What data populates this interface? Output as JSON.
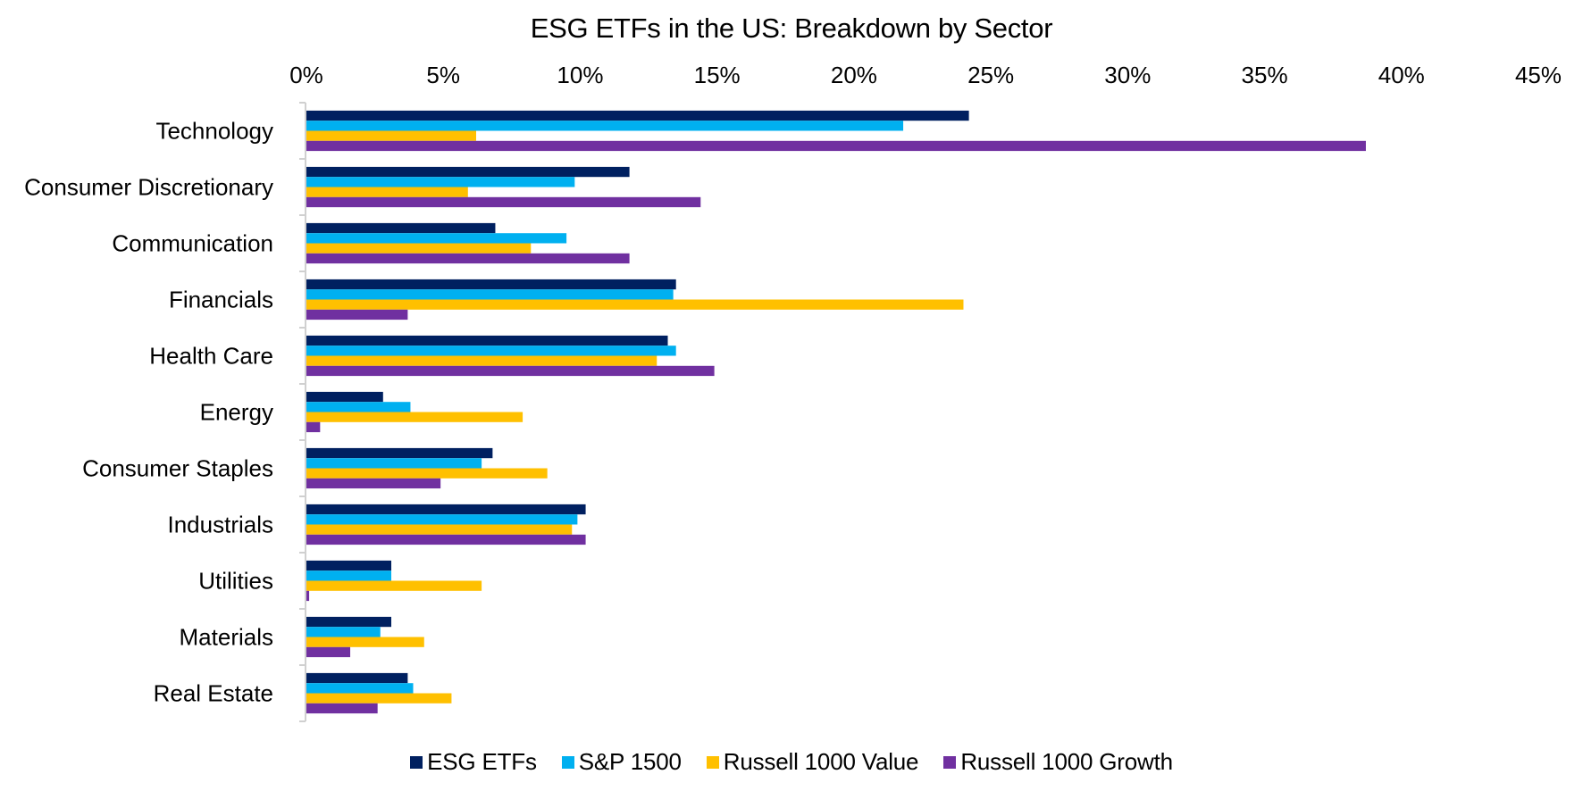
{
  "chart_data": {
    "type": "bar",
    "orientation": "horizontal",
    "title": "ESG ETFs in the US: Breakdown by Sector",
    "xlabel": "",
    "ylabel": "",
    "xlim": [
      0,
      45
    ],
    "x_ticks": [
      0,
      5,
      10,
      15,
      20,
      25,
      30,
      35,
      40,
      45
    ],
    "x_tick_labels": [
      "0%",
      "5%",
      "10%",
      "15%",
      "20%",
      "25%",
      "30%",
      "35%",
      "40%",
      "45%"
    ],
    "x_axis_position": "top",
    "value_unit": "percent",
    "grid": false,
    "legend_position": "bottom",
    "categories": [
      "Technology",
      "Consumer Discretionary",
      "Communication",
      "Financials",
      "Health Care",
      "Energy",
      "Consumer Staples",
      "Industrials",
      "Utilities",
      "Materials",
      "Real Estate"
    ],
    "series": [
      {
        "name": "ESG ETFs",
        "color": "#002060",
        "values": [
          24.2,
          11.8,
          6.9,
          13.5,
          13.2,
          2.8,
          6.8,
          10.2,
          3.1,
          3.1,
          3.7
        ]
      },
      {
        "name": "S&P 1500",
        "color": "#00B0F0",
        "values": [
          21.8,
          9.8,
          9.5,
          13.4,
          13.5,
          3.8,
          6.4,
          9.9,
          3.1,
          2.7,
          3.9
        ]
      },
      {
        "name": "Russell 1000 Value",
        "color": "#FFC000",
        "values": [
          6.2,
          5.9,
          8.2,
          24.0,
          12.8,
          7.9,
          8.8,
          9.7,
          6.4,
          4.3,
          5.3
        ]
      },
      {
        "name": "Russell 1000 Growth",
        "color": "#7030A0",
        "values": [
          38.7,
          14.4,
          11.8,
          3.7,
          14.9,
          0.5,
          4.9,
          10.2,
          0.1,
          1.6,
          2.6
        ]
      }
    ]
  }
}
